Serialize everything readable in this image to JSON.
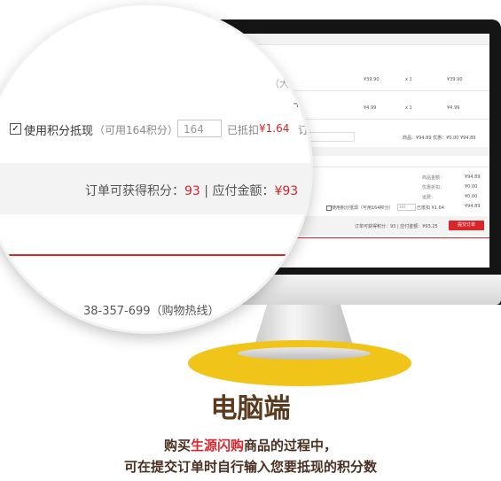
{
  "screen": {
    "rows": [
      {
        "qty": "¥39.90",
        "count": "x 1",
        "sub": "¥39.90"
      },
      {
        "qty": "¥4.99",
        "count": "x 1",
        "sub": "¥4.99"
      }
    ],
    "goods_total_line": "商品：¥94.89   优惠：¥0.00   ¥94.89",
    "summary_labels": [
      "商品金额：",
      "优惠折扣：",
      "运费：",
      ""
    ],
    "summary_values": [
      "¥94.89",
      "¥0.00",
      "¥0.00",
      "¥94.89"
    ],
    "use_points": "使用积分抵现（可用164积分）",
    "points_value": "164",
    "deducted": "已抵扣 ¥1.64",
    "deducted_amount": "¥1.64",
    "earn_line": "订单可获得积分：93 | 应付金额：¥93.25",
    "submit": "提交订单"
  },
  "magnifier": {
    "partial_top": "（大）",
    "plus": "+",
    "use_points_label": "使用积分抵现",
    "available": "（可用164积分）",
    "points_value": "164",
    "deducted_label": "已抵扣",
    "deducted_amount": "¥1.64",
    "cut": "订",
    "earn_label": "订单可获得积分：",
    "earn_points": "93",
    "sep": " | 应付金额：",
    "payable_partial": "¥93",
    "hotline": "38-357-699（购物热线）"
  },
  "caption": {
    "title": "电脑端",
    "line1_pre": "购买",
    "line1_brand": "生源闪购",
    "line1_post": "商品的过程中，",
    "line2": "可在提交订单时自行输入您要抵现的积分数"
  },
  "colors": {
    "accent": "#d9262c",
    "base": "#f0c419",
    "title": "#5b3a1e"
  }
}
